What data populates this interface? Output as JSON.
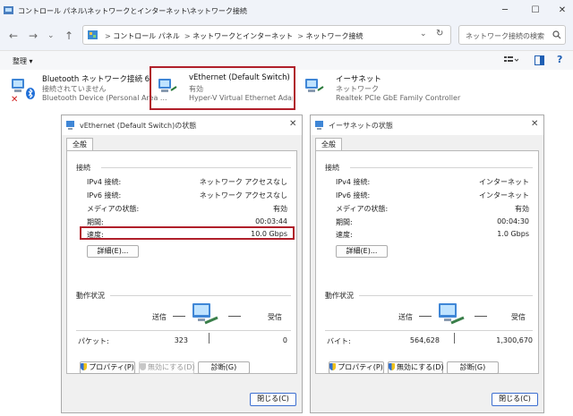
{
  "explorer": {
    "title": "コントロール パネル\\ネットワークとインターネット\\ネットワーク接続",
    "breadcrumbs": [
      "コントロール パネル",
      "ネットワークとインターネット",
      "ネットワーク接続"
    ],
    "search_placeholder": "ネットワーク接続の検索",
    "organize_label": "整理 ▾",
    "adapters": [
      {
        "name": "Bluetooth ネットワーク接続 6",
        "status": "接続されていません",
        "device": "Bluetooth Device (Personal Area ..."
      },
      {
        "name": "vEthernet (Default Switch)",
        "status": "有効",
        "device": "Hyper-V Virtual Ethernet Adapter"
      },
      {
        "name": "イーサネット",
        "status": "ネットワーク",
        "device": "Realtek PCIe GbE Family Controller"
      }
    ]
  },
  "dialog_left": {
    "title": "vEthernet (Default Switch)の状態",
    "tab": "全般",
    "section_conn": "接続",
    "rows": [
      {
        "label": "IPv4 接続:",
        "value": "ネットワーク アクセスなし"
      },
      {
        "label": "IPv6 接続:",
        "value": "ネットワーク アクセスなし"
      },
      {
        "label": "メディアの状態:",
        "value": "有効"
      },
      {
        "label": "期間:",
        "value": "00:03:44"
      },
      {
        "label": "速度:",
        "value": "10.0 Gbps"
      }
    ],
    "details_btn": "詳細(E)...",
    "section_activity": "動作状況",
    "sent": "送信",
    "received": "受信",
    "unit_label": "パケット:",
    "sent_value": "323",
    "received_value": "0",
    "props_btn": "プロパティ(P)",
    "disable_btn": "無効にする(D)",
    "diag_btn": "診断(G)",
    "close_btn": "閉じる(C)"
  },
  "dialog_right": {
    "title": "イーサネットの状態",
    "tab": "全般",
    "section_conn": "接続",
    "rows": [
      {
        "label": "IPv4 接続:",
        "value": "インターネット"
      },
      {
        "label": "IPv6 接続:",
        "value": "インターネット"
      },
      {
        "label": "メディアの状態:",
        "value": "有効"
      },
      {
        "label": "期間:",
        "value": "00:04:30"
      },
      {
        "label": "速度:",
        "value": "1.0 Gbps"
      }
    ],
    "details_btn": "詳細(E)...",
    "section_activity": "動作状況",
    "sent": "送信",
    "received": "受信",
    "unit_label": "バイト:",
    "sent_value": "564,628",
    "received_value": "1,300,670",
    "props_btn": "プロパティ(P)",
    "disable_btn": "無効にする(D)",
    "diag_btn": "診断(G)",
    "close_btn": "閉じる(C)"
  },
  "colors": {
    "highlight": "#b01f2a",
    "accent": "#2f6fd0"
  }
}
